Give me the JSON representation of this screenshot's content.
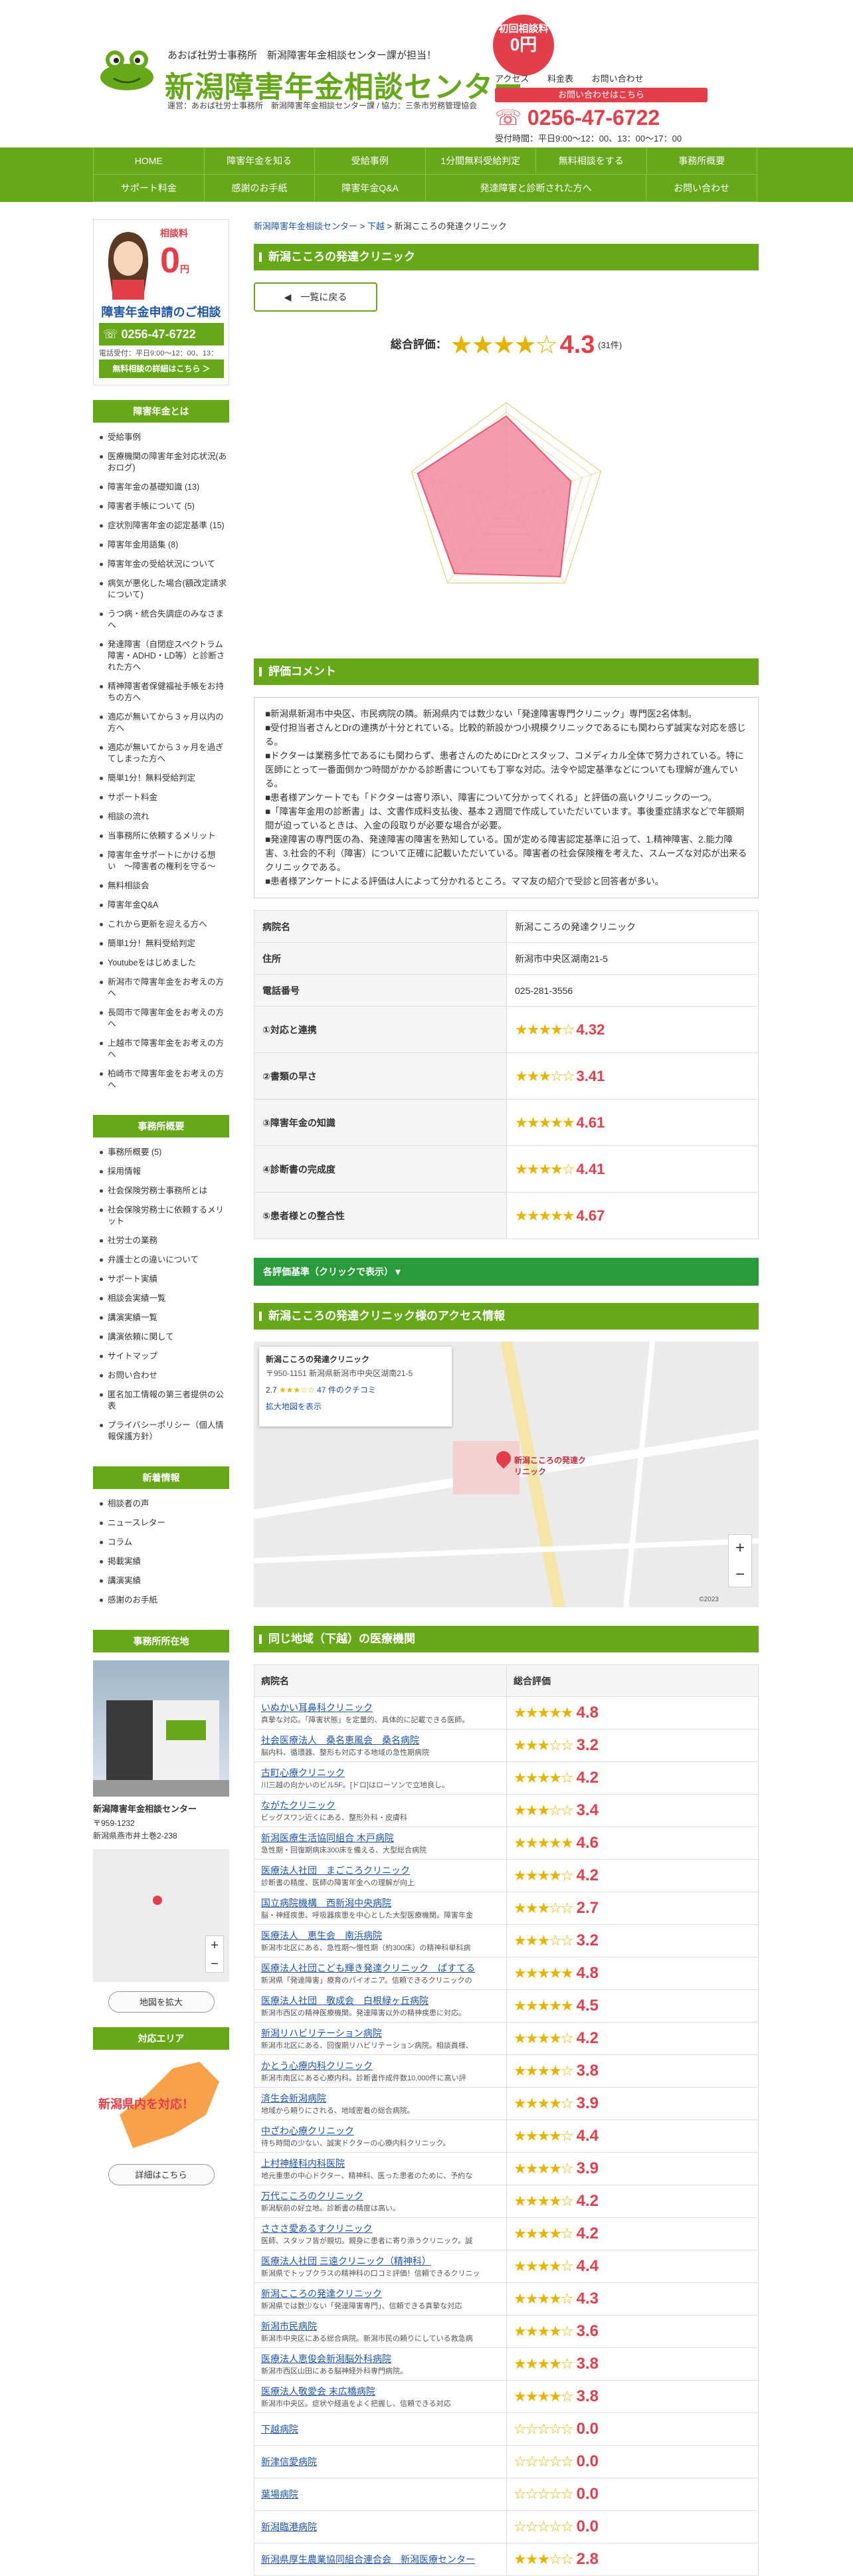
{
  "header": {
    "tagline": "あおば社労士事務所　新潟障害年金相談センター課が担当！",
    "title": "新潟障害年金相談センター",
    "subtitle": "運営：あおば社労士事務所　新潟障害年金相談センター課 / 協力：三条市労務管理協会",
    "badge_top": "初回相談料",
    "badge_price": "0円",
    "links": [
      "アクセス",
      "料金表",
      "お問い合わせ"
    ],
    "contact_btn": "お問い合わせはこちら",
    "phone": "0256-47-6722",
    "hours": "受付時間：平日9:00〜12：00、13：00〜17：00"
  },
  "nav": {
    "row1": [
      "HOME",
      "障害年金を知る",
      "受給事例",
      "1分間無料受給判定",
      "無料相談をする",
      "事務所概要"
    ],
    "row2": [
      "サポート料金",
      "感謝のお手紙",
      "障害年金Q&A",
      "発達障害と診断された方へ",
      "お問い合わせ"
    ]
  },
  "sidebar": {
    "price_label": "相談料",
    "price_value": "0",
    "price_unit": "円",
    "heading": "障害年金申請のご相談",
    "phone": "0256-47-6722",
    "hours": "電話受付：平日9:00〜12：00、13：00〜17：00",
    "consult_btn": "無料相談の詳細はこちら ＞",
    "sec1_title": "障害年金とは",
    "sec1_items": [
      "受給事例",
      "医療機関の障害年金対応状況(あおログ)",
      "障害年金の基礎知識 (13)",
      "障害者手帳について (5)",
      "症状別障害年金の認定基準 (15)",
      "障害年金用語集 (8)",
      "障害年金の受給状況について",
      "病気が悪化した場合(額改定請求について)",
      "うつ病・統合失調症のみなさまへ",
      "発達障害（自閉症スペクトラム障害・ADHD・LD等）と診断された方へ",
      "精神障害者保健福祉手帳をお持ちの方へ",
      "適応が無いてから３ヶ月以内の方へ",
      "適応が無いてから３ヶ月を過ぎてしまった方へ",
      "簡単1分！無料受給判定",
      "サポート料金",
      "相談の流れ",
      "当事務所に依頼するメリット",
      "障害年金サポートにかける想い　〜障害者の権利を守る〜",
      "無料相談会",
      "障害年金Q&A",
      "これから更新を迎える方へ",
      "簡単1分！無料受給判定",
      "Youtubeをはじめました",
      "新潟市で障害年金をお考えの方へ",
      "長岡市で障害年金をお考えの方へ",
      "上越市で障害年金をお考えの方へ",
      "柏崎市で障害年金をお考えの方へ"
    ],
    "sec2_title": "事務所概要",
    "sec2_items": [
      "事務所概要 (5)",
      "採用情報",
      "社会保険労務士事務所とは",
      "社会保険労務士に依頼するメリット",
      "社労士の業務",
      "弁護士との違いについて",
      "サポート実績",
      "相談会実績一覧",
      "講演実績一覧",
      "講演依頼に関して",
      "サイトマップ",
      "お問い合わせ",
      "匿名加工情報の第三者提供の公表",
      "プライバシーポリシー（個人情報保護方針）"
    ],
    "sec3_title": "新着情報",
    "sec3_items": [
      "相談者の声",
      "ニュースレター",
      "コラム",
      "掲載実績",
      "講演実績",
      "感謝のお手紙"
    ],
    "sec4_title": "事務所所在地",
    "office_name": "新潟障害年金相談センター",
    "office_zip": "〒959-1232",
    "office_addr": "新潟県燕市井土巻2-238",
    "map_btn": "地図を拡大",
    "sec5_title": "対応エリア",
    "area_text": "新潟県内を対応！",
    "area_btn": "詳細はこちら"
  },
  "main": {
    "breadcrumb": [
      "新潟障害年金相談センター",
      "下越",
      "新潟こころの発達クリニック"
    ],
    "page_title": "新潟こころの発達クリニック",
    "back_btn": "一覧に戻る",
    "overall_label": "総合評価：",
    "overall_score": "4.3",
    "overall_count": "(31件)",
    "comment_title": "評価コメント",
    "comments": [
      "■新潟県新潟市中央区、市民病院の隣。新潟県内では数少ない「発達障害専門クリニック」専門医2名体制。",
      "■受付担当者さんとDrの連携が十分とれている。比較的新設かつ小規模クリニックであるにも関わらず誠実な対応を感じる。",
      "■ドクターは業務多忙であるにも関わらず、患者さんのためにDrとスタッフ、コメディカル全体で努力されている。特に医師にとって一番面倒かつ時間がかかる診断書についても丁寧な対応。法令や認定基準などについても理解が進んでいる。",
      "■患者様アンケートでも「ドクターは寄り添い、障害について分かってくれる」と評価の高いクリニックの一つ。",
      "■「障害年金用の診断書」は、文書作成料支払後、基本２週間で作成していただいています。事後重症請求などで年額期間が迫っているときは、入金の段取りが必要な場合が必要。",
      "■発達障害の専門医の為、発達障害の障害を熟知している。国が定める障害認定基準に沿って、1.精神障害、2.能力障害、3.社会的不利（障害）について正確に記載いただいている。障害者の社会保険権を考えた、スムーズな対応が出来るクリニックである。",
      "■患者様アンケートによる評価は人によって分かれるところ。ママ友の紹介で受診と回答者が多い。"
    ],
    "info_rows": [
      {
        "label": "病院名",
        "value": "新潟こころの発達クリニック"
      },
      {
        "label": "住所",
        "value": "新潟市中央区湖南21-5"
      },
      {
        "label": "電話番号",
        "value": "025-281-3556"
      }
    ],
    "score_rows": [
      {
        "label": "①対応と連携",
        "score": "4.32"
      },
      {
        "label": "②書類の早さ",
        "score": "3.41"
      },
      {
        "label": "③障害年金の知識",
        "score": "4.61"
      },
      {
        "label": "④診断書の完成度",
        "score": "4.41"
      },
      {
        "label": "⑤患者様との整合性",
        "score": "4.67"
      }
    ],
    "criteria_label": "各評価基準（クリックで表示）▼",
    "access_title": "新潟こころの発達クリニック様のアクセス情報",
    "map_card_name": "新潟こころの発達クリニック",
    "map_card_addr": "〒950-1151 新潟県新潟市中央区湖南21-5",
    "map_card_rating": "2.7",
    "map_card_reviews": "47 件のクチコミ",
    "map_card_link": "拡大地図を表示",
    "map_pin_label": "新潟こころの発達クリニック",
    "map_copyright": "©2023",
    "region_title": "同じ地域（下越）の医療機関",
    "col_name": "病院名",
    "col_score": "総合評価",
    "hospitals": [
      {
        "name": "いぬかい耳鼻科クリニック",
        "desc": "真摯な対応。「障害状態」を定量的、具体的に記載できる医師。",
        "score": "4.8"
      },
      {
        "name": "社会医療法人　桑名恵風会　桑名病院",
        "desc": "脳内科、循環器、整形も対応する地域の急性期病院",
        "score": "3.2"
      },
      {
        "name": "古町心療クリニック",
        "desc": "川三越の向かいのビル5F。[ドロ]はローソンで立地良し。",
        "score": "4.2"
      },
      {
        "name": "ながたクリニック",
        "desc": "ビッグスワン近くにある、整形外科・皮膚科",
        "score": "3.4"
      },
      {
        "name": "新潟医療生活協同組合 木戸病院",
        "desc": "急性期・回復期病床300床を備える、大型総合病院",
        "score": "4.6"
      },
      {
        "name": "医療法人社団　まごころクリニック",
        "desc": "診断書の精度、医師の障害年金への理解が向上",
        "score": "4.2"
      },
      {
        "name": "国立病院機構　西新潟中央病院",
        "desc": "脳・神経疾患、呼吸器疾患を中心とした大型医療機関。障害年金",
        "score": "2.7"
      },
      {
        "name": "医療法人　恵生会　南浜病院",
        "desc": "新潟市北区にある、急性期〜慢性期（約300床）の精神科単科病",
        "score": "3.2"
      },
      {
        "name": "医療法人社団こども輝き発達クリニック　ぱすてる",
        "desc": "新潟県「発達障害」療育のパイオニア。信頼できるクリニックの",
        "score": "4.8"
      },
      {
        "name": "医療法人社団　敬成会　白根緑ヶ丘病院",
        "desc": "新潟市西区の精神医療機関。発達障害以外の精神疾患に対応。",
        "score": "4.5"
      },
      {
        "name": "新潟リハビリテーション病院",
        "desc": "新潟市北区にある、回復期リハビリテーション病院。相談員様、",
        "score": "4.2"
      },
      {
        "name": "かとう心療内科クリニック",
        "desc": "新潟市南区にある心療内科。診断書作成件数10,000件に高い評",
        "score": "3.8"
      },
      {
        "name": "済生会新潟病院",
        "desc": "地域から頼りにされる、地域密着の総合病院。",
        "score": "3.9"
      },
      {
        "name": "中ざわ心療クリニック",
        "desc": "待ち時間の少ない、誠実ドクターの心療内科クリニック。",
        "score": "4.4"
      },
      {
        "name": "上村神経科内科医院",
        "desc": "地元重患の中心ドクター、精神科、医った患者のために、予約な",
        "score": "3.9"
      },
      {
        "name": "万代こころのクリニック",
        "desc": "新潟駅前の好立地。診断書の精度は高い。",
        "score": "4.2"
      },
      {
        "name": "さささ愛あるすクリニック",
        "desc": "医師、スタッフ皆が親切。親身に患者に寄り添うクリニック。誠",
        "score": "4.2"
      },
      {
        "name": "医療法人社団 三遠クリニック（精神科）",
        "desc": "新潟県でトップクラスの精神科の口コミ評価！信頼できるクリニッ",
        "score": "4.4"
      },
      {
        "name": "新潟こころの発達クリニック",
        "desc": "新潟県では数少ない「発達障害専門」、信頼できる真摯な対応",
        "score": "4.3"
      },
      {
        "name": "新潟市民病院",
        "desc": "新潟市中央区にある総合病院。新潟市民の頼りにしている救急病",
        "score": "3.6"
      },
      {
        "name": "医療法人恵俊会新潟脳外科病院",
        "desc": "新潟市西区山田にある脳神経外科専門病院。",
        "score": "3.8"
      },
      {
        "name": "医療法人敬愛会 末広橋病院",
        "desc": "新潟市中央区。症状や経過をよく把握し、信頼できる対応",
        "score": "3.8"
      },
      {
        "name": "下越病院",
        "desc": "",
        "score": "0.0"
      },
      {
        "name": "新津信愛病院",
        "desc": "",
        "score": "0.0"
      },
      {
        "name": "葉場病院",
        "desc": "",
        "score": "0.0"
      },
      {
        "name": "新潟臨港病院",
        "desc": "",
        "score": "0.0"
      },
      {
        "name": "新潟県厚生農業協同組合連合会　新潟医療センター",
        "desc": "",
        "score": "2.8"
      }
    ]
  }
}
